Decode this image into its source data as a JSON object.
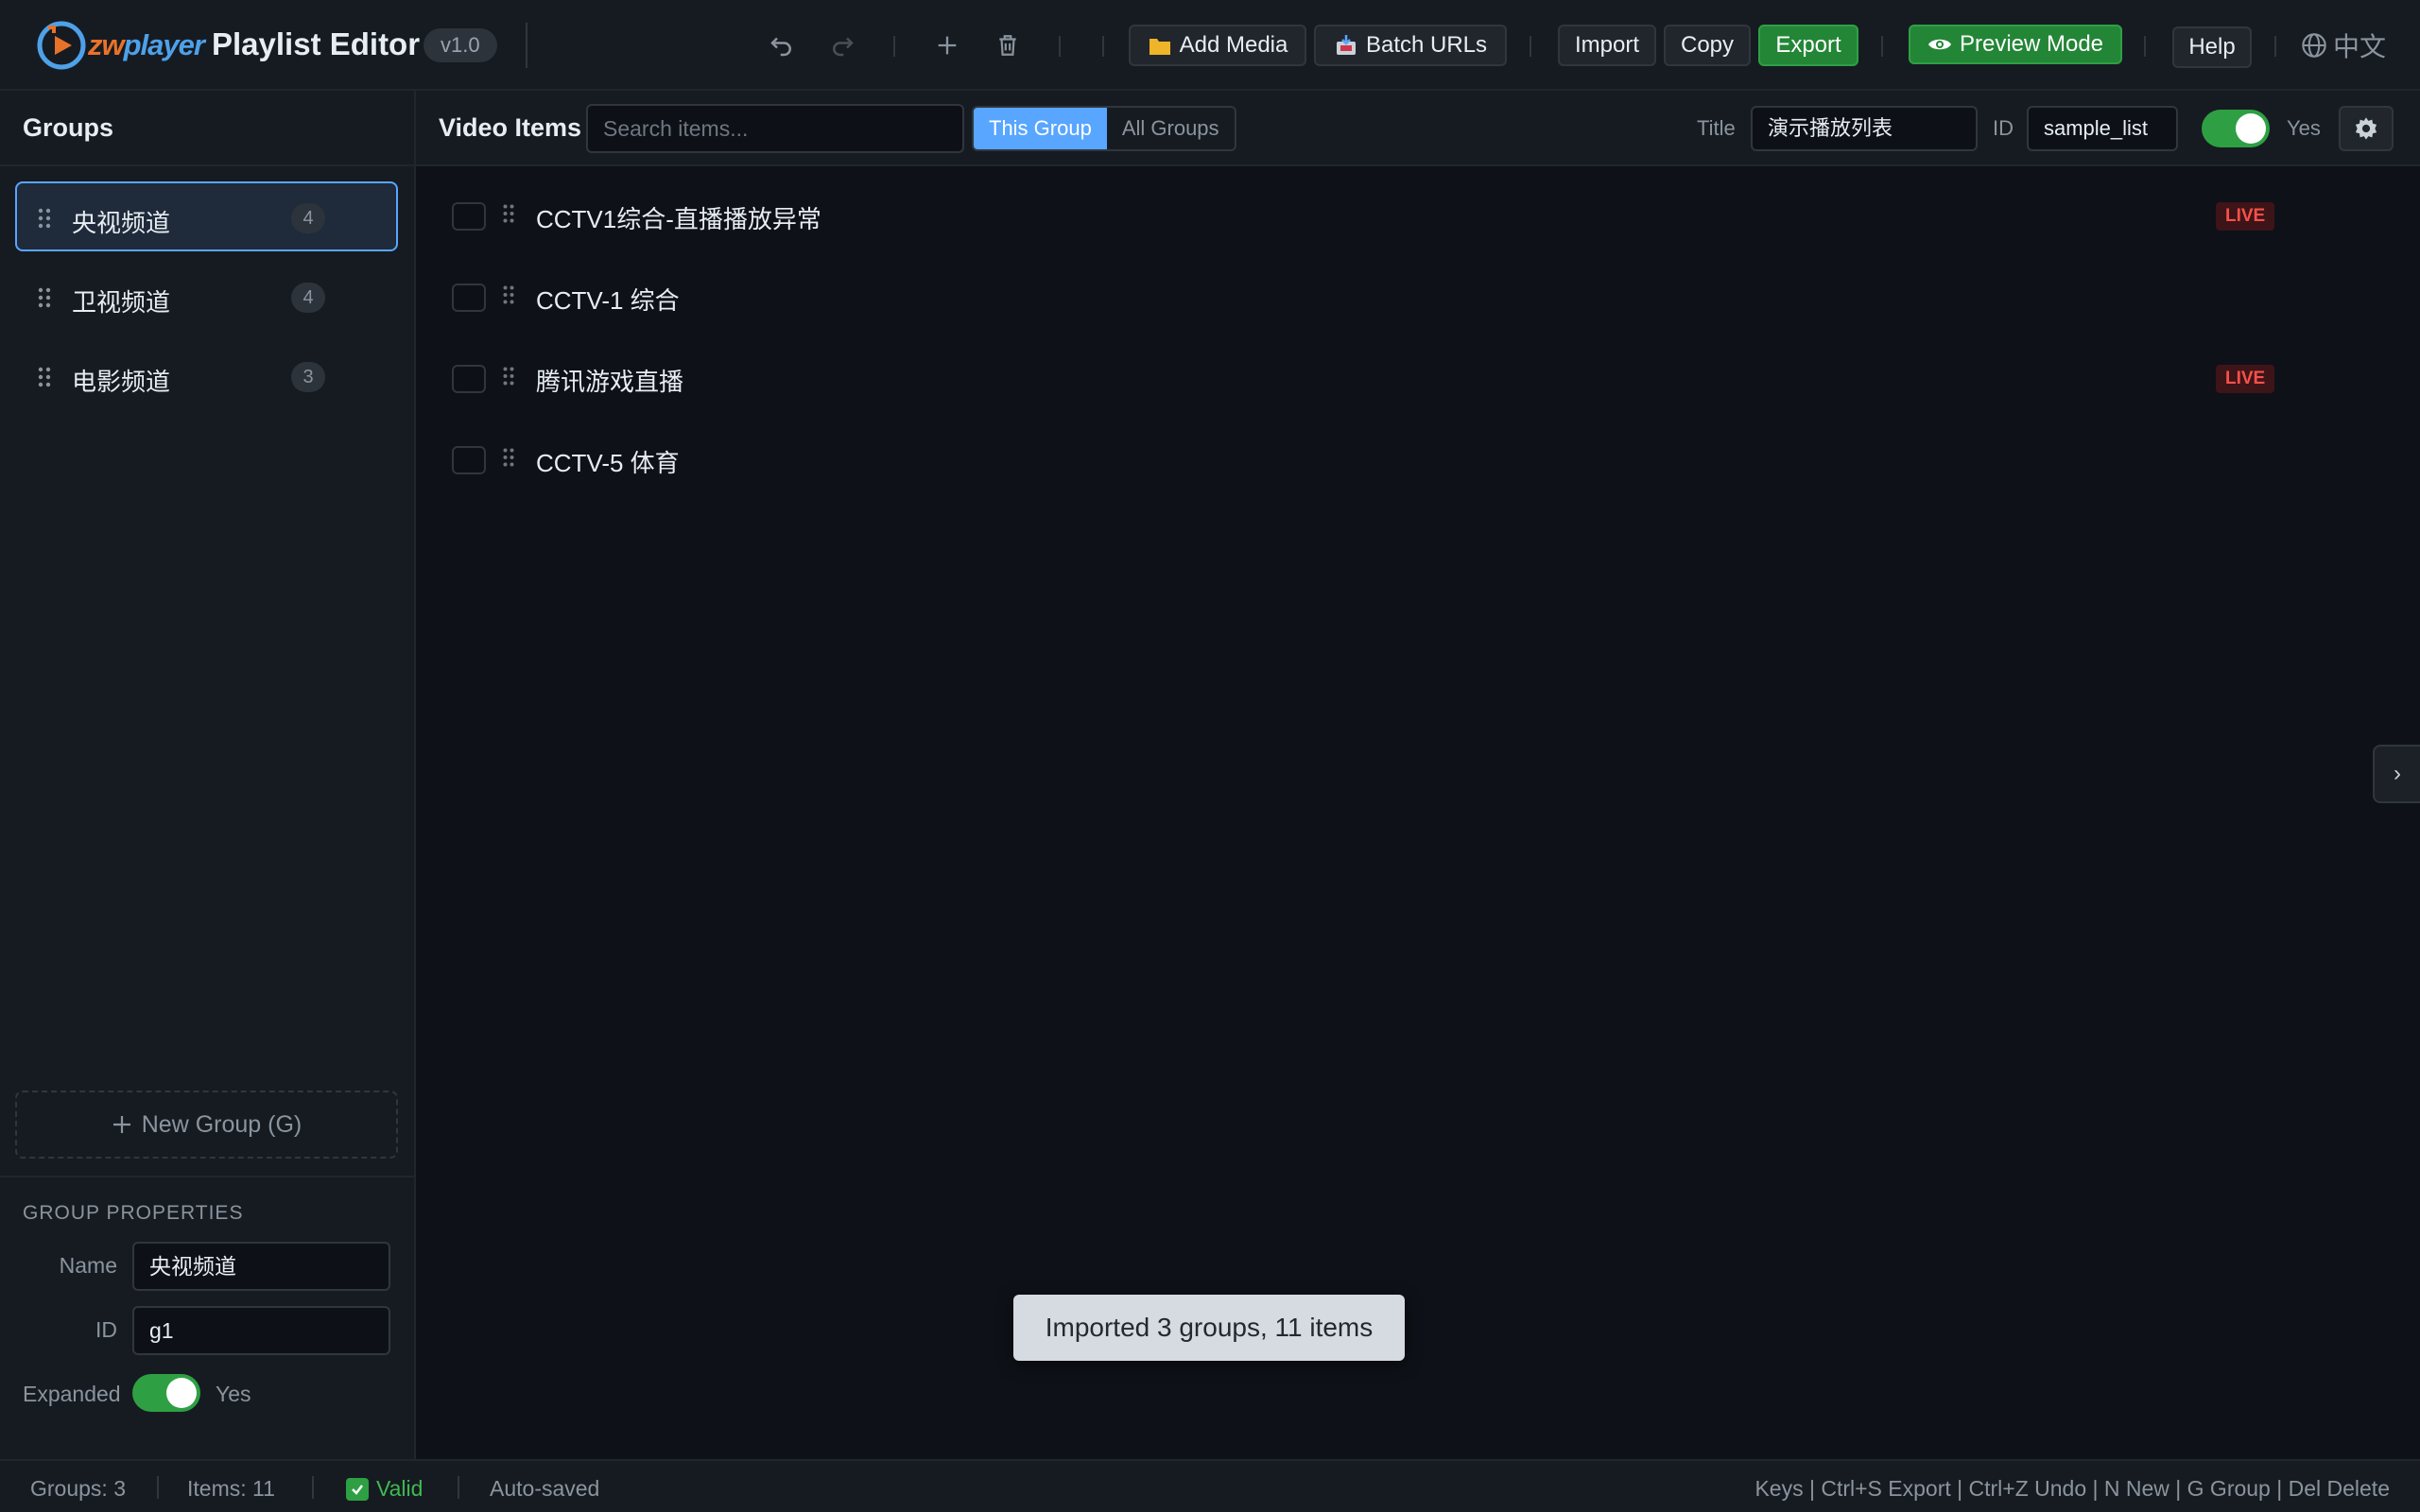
{
  "header": {
    "logo_prefix": "zw",
    "logo_suffix": "player",
    "app_title": "Playlist Editor",
    "version": "v1.0",
    "add_media_label": "Add Media",
    "batch_urls_label": "Batch URLs",
    "import_label": "Import",
    "copy_label": "Copy",
    "export_label": "Export",
    "preview_label": "Preview Mode",
    "help_label": "Help",
    "language_label": "中文"
  },
  "sidebar": {
    "title": "Groups",
    "groups": [
      {
        "label": "央视频道",
        "count": "4",
        "active": true
      },
      {
        "label": "卫视频道",
        "count": "4",
        "active": false
      },
      {
        "label": "电影频道",
        "count": "3",
        "active": false
      }
    ],
    "new_group_label": "New Group (G)",
    "properties": {
      "title": "GROUP PROPERTIES",
      "name_label": "Name",
      "name_value": "央视频道",
      "id_label": "ID",
      "id_value": "g1",
      "expanded_label": "Expanded",
      "expanded_value": "Yes"
    }
  },
  "main": {
    "title": "Video Items",
    "search_placeholder": "Search items...",
    "scope_this": "This Group",
    "scope_all": "All Groups",
    "title_label": "Title",
    "title_value": "演示播放列表",
    "id_label": "ID",
    "id_value": "sample_list",
    "enabled_value": "Yes",
    "items": [
      {
        "title": "CCTV1综合-直播播放异常",
        "badge": "LIVE"
      },
      {
        "title": "CCTV-1 综合",
        "badge": ""
      },
      {
        "title": "腾讯游戏直播",
        "badge": "LIVE"
      },
      {
        "title": "CCTV-5 体育",
        "badge": ""
      }
    ],
    "collapse_glyph": "›"
  },
  "toast": {
    "message": "Imported 3 groups, 11 items"
  },
  "status": {
    "groups": "Groups: 3",
    "items": "Items: 11",
    "valid": "Valid",
    "autosave": "Auto-saved",
    "keys": "Keys | Ctrl+S Export | Ctrl+Z Undo | N New | G Group | Del Delete"
  },
  "colors": {
    "accent": "#58a6ff",
    "success": "#238636",
    "live": "#f85149",
    "background": "#0e1117",
    "panel": "#161b22"
  }
}
